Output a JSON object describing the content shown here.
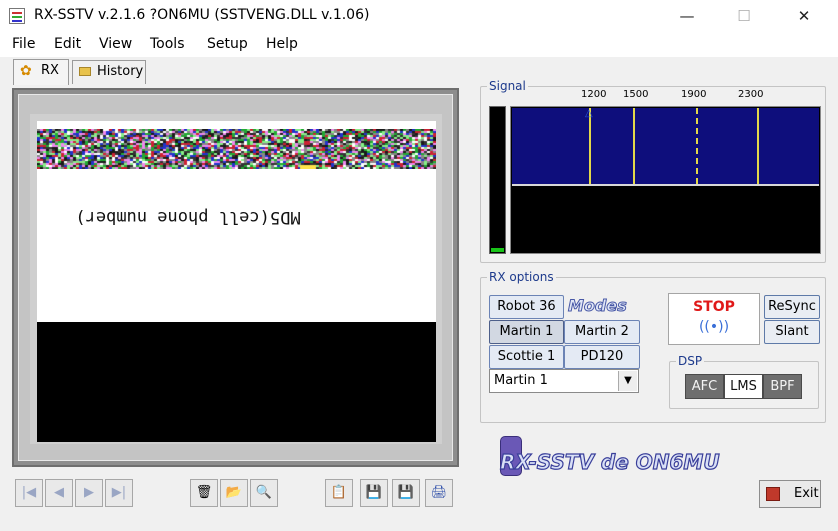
{
  "window": {
    "title": "RX-SSTV v.2.1.6 ?ON6MU (SSTVENG.DLL v.1.06)",
    "minimize_glyph": "—",
    "maximize_glyph": "☐",
    "close_glyph": "✕"
  },
  "menu": [
    "File",
    "Edit",
    "View",
    "Tools",
    "Setup",
    "Help"
  ],
  "tabs": [
    {
      "label": "RX",
      "icon": "gear-icon",
      "active": true
    },
    {
      "label": "History",
      "icon": "folder-icon",
      "active": false
    }
  ],
  "image": {
    "mirrored_text": "MD5(cell phone number)",
    "colors": {
      "image_bg": "#ffffff",
      "bottom_band": "#000000"
    }
  },
  "nav_buttons": [
    {
      "name": "first-button",
      "glyph": "|◀"
    },
    {
      "name": "prev-button",
      "glyph": "◀"
    },
    {
      "name": "next-button",
      "glyph": "▶"
    },
    {
      "name": "last-button",
      "glyph": "▶|"
    }
  ],
  "file_buttons": [
    {
      "name": "trash-button",
      "glyph": "🗑"
    },
    {
      "name": "open-folder-button",
      "glyph": "📂"
    },
    {
      "name": "zoom-button",
      "glyph": "🔍"
    }
  ],
  "save_buttons": [
    {
      "name": "copy-button",
      "glyph": "📋"
    },
    {
      "name": "save-button",
      "glyph": "💾"
    },
    {
      "name": "save-as-button",
      "glyph": "💾"
    },
    {
      "name": "tx-button",
      "glyph": "🖨"
    }
  ],
  "signal": {
    "legend": "Signal",
    "freq_labels": [
      "1200",
      "1500",
      "1900",
      "2300"
    ],
    "sync_marker_glyph": "△",
    "colors": {
      "waterfall": "#0e0e7c",
      "freq_line": "#e3d84a",
      "level": "#19c419"
    }
  },
  "rx_options": {
    "legend": "RX options",
    "modes_logo": "Modes",
    "mode_buttons": [
      {
        "label": "Robot 36",
        "selected": false
      },
      {
        "label": "Martin 1",
        "selected": true
      },
      {
        "label": "Martin 2",
        "selected": false
      },
      {
        "label": "Scottie 1",
        "selected": false
      },
      {
        "label": "PD120",
        "selected": false
      }
    ],
    "mode_select_value": "Martin 1",
    "stop_label": "STOP",
    "resync_label": "ReSync",
    "slant_label": "Slant",
    "dsp": {
      "legend": "DSP",
      "buttons": [
        {
          "label": "AFC",
          "on": true
        },
        {
          "label": "LMS",
          "on": false
        },
        {
          "label": "BPF",
          "on": true
        }
      ]
    }
  },
  "logo_text": "RX-SSTV de ON6MU",
  "exit_label": "Exit"
}
